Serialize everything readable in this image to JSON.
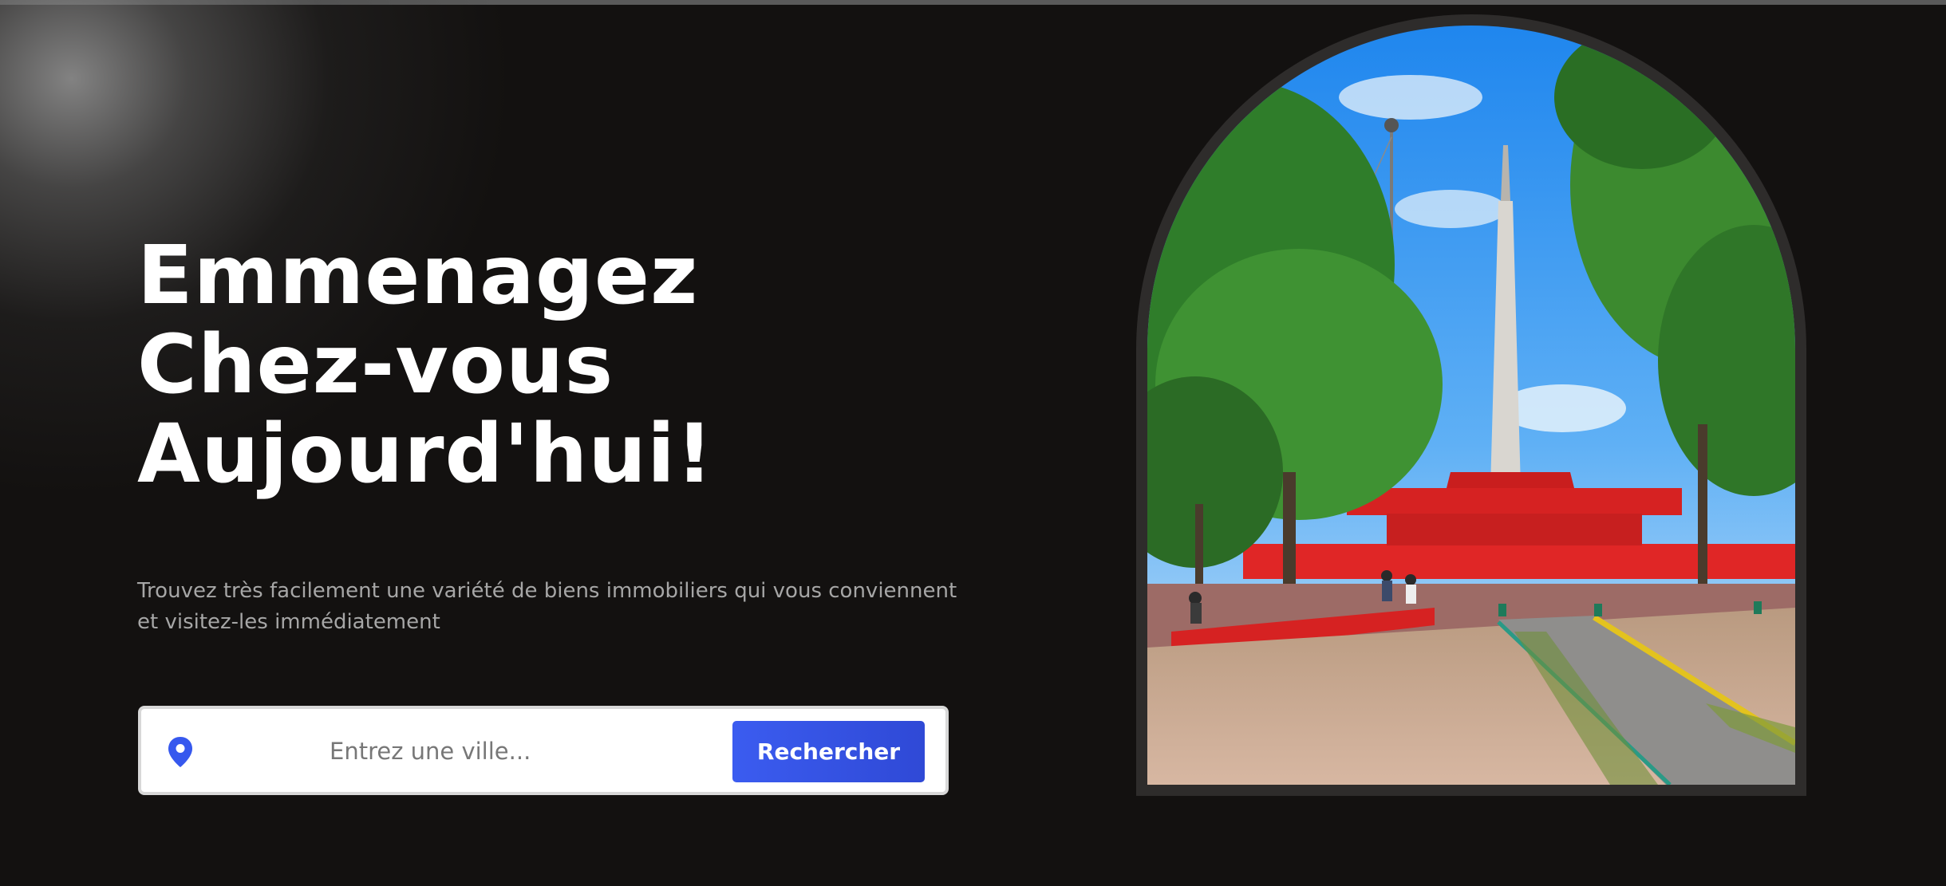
{
  "hero": {
    "title_lines": [
      "Emmenagez",
      "Chez-vous",
      "Aujourd'hui!"
    ],
    "subtitle": "Trouvez très facilement une variété de biens immobiliers qui vous conviennent et visitez-les immédiatement"
  },
  "search": {
    "placeholder": "Entrez une ville...",
    "button_label": "Rechercher",
    "icon": "location-pin-icon"
  },
  "colors": {
    "background": "#131110",
    "accent": "#3b5cf0",
    "subtitle": "#a6a6a6"
  },
  "image": {
    "subject": "monument-park-photo"
  }
}
